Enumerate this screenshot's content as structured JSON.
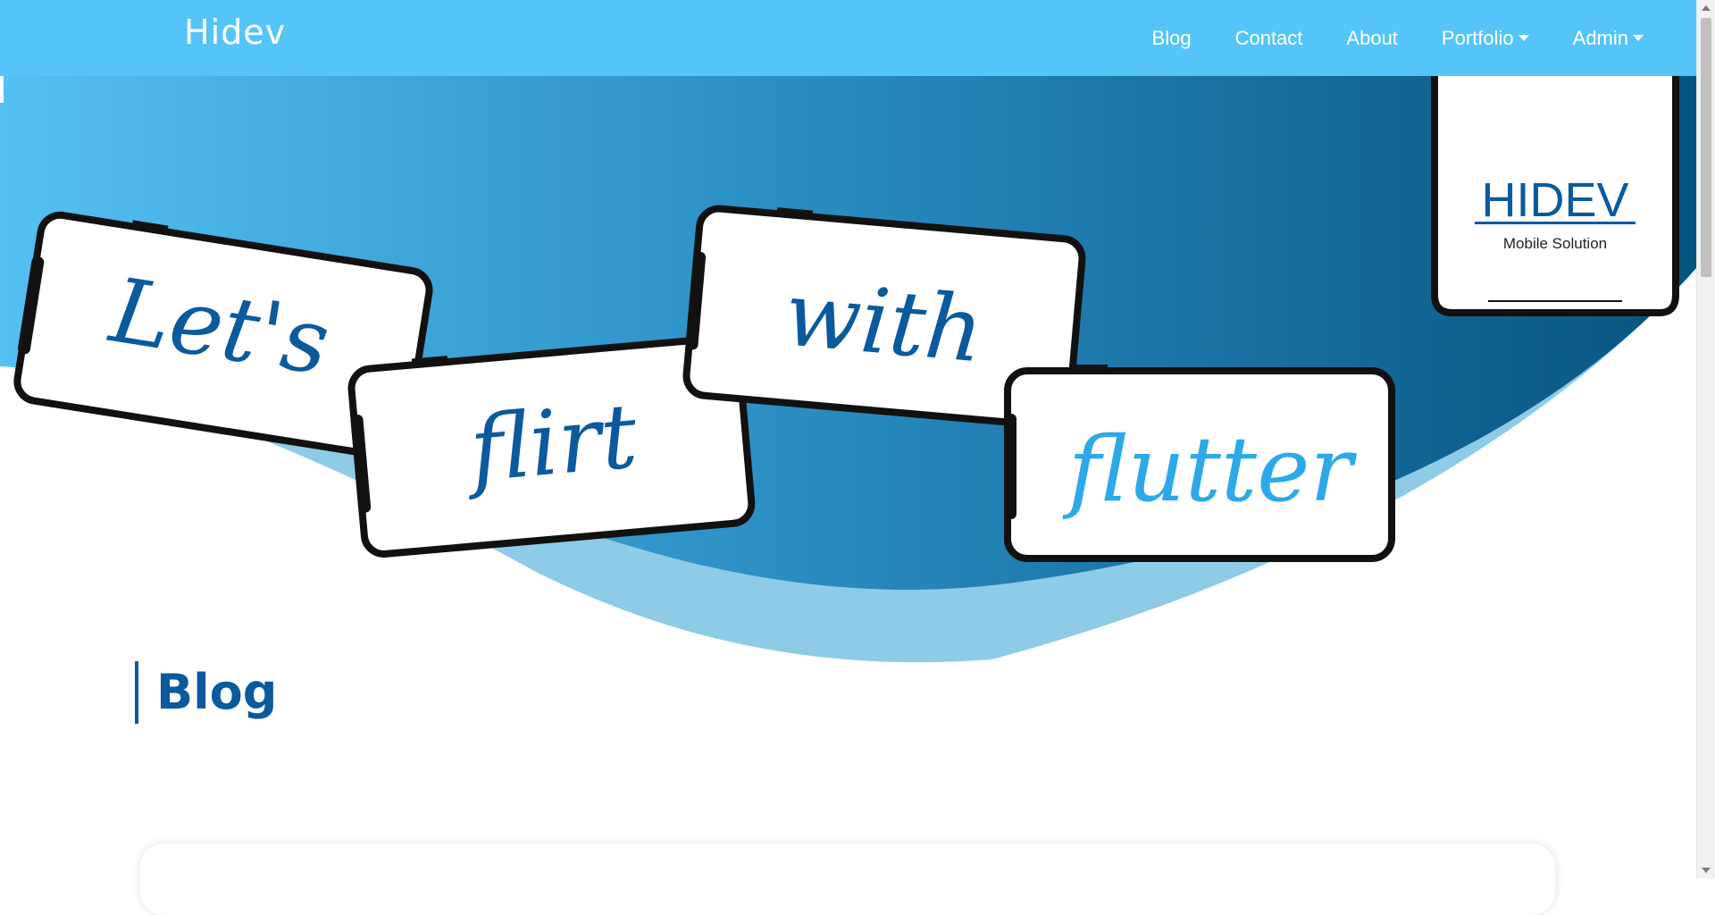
{
  "navbar": {
    "brand": "Hidev",
    "links": [
      {
        "label": "Blog"
      },
      {
        "label": "Contact"
      },
      {
        "label": "About"
      },
      {
        "label": "Portfolio",
        "dropdown": true
      },
      {
        "label": "Admin",
        "dropdown": true
      }
    ]
  },
  "hero": {
    "phones": [
      "Let's",
      "flirt",
      "with",
      "flutter"
    ],
    "logo": {
      "title": "HIDEV",
      "subtitle": "Mobile Solution"
    }
  },
  "section": {
    "title": "Blog"
  },
  "colors": {
    "navbar": "#55c4f9",
    "dark_blue": "#0b5a9e",
    "light_blue": "#2ea9e8",
    "wave_light": "#8ecbe6"
  },
  "icons": [
    "caret-down-icon",
    "scroll-up-arrow-icon",
    "scroll-down-arrow-icon"
  ]
}
